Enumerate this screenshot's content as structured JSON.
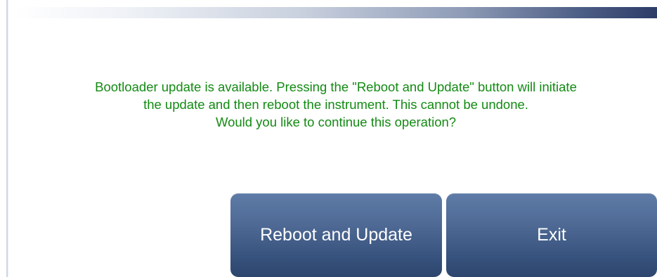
{
  "dialog": {
    "message_lines": [
      "Bootloader update is available. Pressing the \"Reboot and Update\" button will initiate",
      "the update and then reboot the instrument. This cannot be undone.",
      "Would you like to continue this operation?"
    ]
  },
  "buttons": {
    "reboot_label": "Reboot and Update",
    "exit_label": "Exit"
  },
  "colors": {
    "message_text": "#138a13",
    "button_top": "#5e7ca7",
    "button_bottom": "#2d466e",
    "header_dark": "#2c3c66"
  }
}
